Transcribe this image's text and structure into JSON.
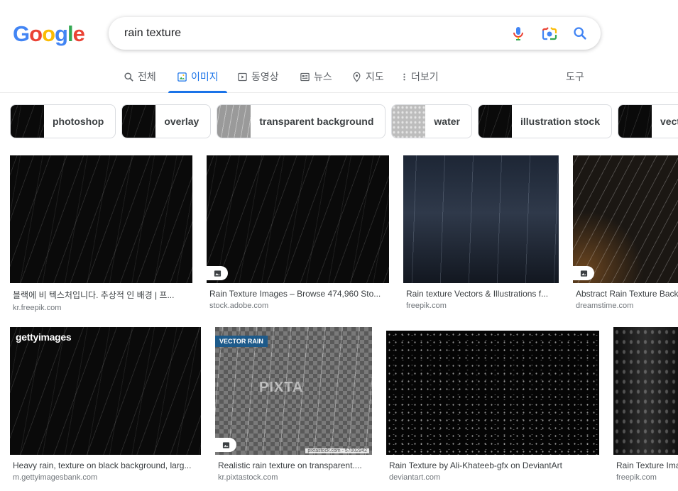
{
  "brand": {
    "logo_letters": [
      "G",
      "o",
      "o",
      "g",
      "l",
      "e"
    ],
    "logo_colors": [
      "#4285F4",
      "#EA4335",
      "#FBBC05",
      "#4285F4",
      "#34A853",
      "#EA4335"
    ]
  },
  "search": {
    "query": "rain texture"
  },
  "tabs": [
    {
      "label": "전체",
      "icon": "search-icon",
      "active": false
    },
    {
      "label": "이미지",
      "icon": "image-icon",
      "active": true
    },
    {
      "label": "동영상",
      "icon": "video-icon",
      "active": false
    },
    {
      "label": "뉴스",
      "icon": "news-icon",
      "active": false
    },
    {
      "label": "지도",
      "icon": "map-pin-icon",
      "active": false
    },
    {
      "label": "더보기",
      "icon": "more-vert-icon",
      "active": false
    }
  ],
  "tools_label": "도구",
  "chips": [
    "photoshop",
    "overlay",
    "transparent background",
    "water",
    "illustration stock",
    "vector"
  ],
  "results": [
    {
      "caption": "블랙에 비 텍스처입니다. 추상적 인 배경 | 프...",
      "source": "kr.freepik.com"
    },
    {
      "caption": "Rain Texture Images – Browse 474,960 Sto...",
      "source": "stock.adobe.com"
    },
    {
      "caption": "Rain texture Vectors & Illustrations f...",
      "source": "freepik.com"
    },
    {
      "caption": "Abstract Rain Texture Back",
      "source": "dreamstime.com"
    },
    {
      "caption": "Heavy rain, texture on black background, larg...",
      "source": "m.gettyimagesbank.com",
      "overlay": "gettyimages"
    },
    {
      "caption": "Realistic rain texture on transparent....",
      "source": "kr.pixtastock.com",
      "overlay": "VECTOR RAIN",
      "watermark": "PIXTA",
      "footer": "pixtastock.com - 57002942"
    },
    {
      "caption": "Rain Texture by Ali-Khateeb-gfx on DeviantArt",
      "source": "deviantart.com"
    },
    {
      "caption": "Rain Texture Ima",
      "source": "freepik.com"
    }
  ]
}
